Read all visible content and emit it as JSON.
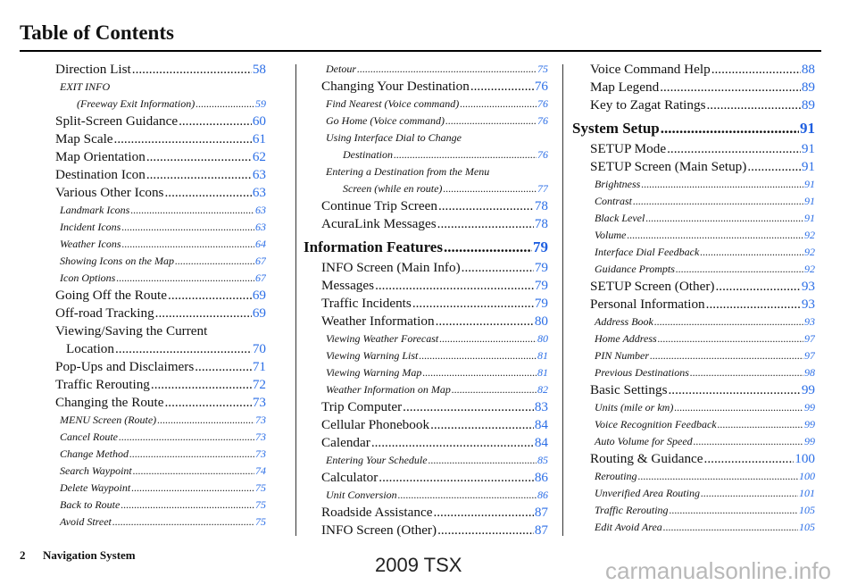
{
  "page": {
    "title": "Table of Contents",
    "footer_page_number": "2",
    "footer_section": "Navigation System",
    "model": "2009  TSX",
    "watermark": "carmanualsonline.info"
  },
  "colors": {
    "link": "#2b6ee6",
    "text": "#111111"
  },
  "columns": [
    {
      "entries": [
        {
          "level": "main",
          "text": "Direction List",
          "page": "58"
        },
        {
          "level": "subplain",
          "text": "EXIT INFO"
        },
        {
          "level": "sub2",
          "text": "(Freeway Exit Information)",
          "page": "59"
        },
        {
          "level": "main",
          "text": "Split-Screen Guidance",
          "page": "60"
        },
        {
          "level": "main",
          "text": "Map Scale",
          "page": "61"
        },
        {
          "level": "main",
          "text": "Map Orientation",
          "page": "62"
        },
        {
          "level": "main",
          "text": "Destination Icon",
          "page": "63"
        },
        {
          "level": "main",
          "text": "Various Other Icons",
          "page": "63"
        },
        {
          "level": "sub",
          "text": "Landmark Icons",
          "page": "63"
        },
        {
          "level": "sub",
          "text": "Incident Icons",
          "page": "63"
        },
        {
          "level": "sub",
          "text": "Weather Icons",
          "page": "64"
        },
        {
          "level": "sub",
          "text": "Showing Icons on the Map",
          "page": "67"
        },
        {
          "level": "sub",
          "text": "Icon Options",
          "page": "67"
        },
        {
          "level": "main",
          "text": "Going Off the Route",
          "page": "69"
        },
        {
          "level": "main",
          "text": "Off-road Tracking",
          "page": "69"
        },
        {
          "level": "mainplain",
          "text": "Viewing/Saving the Current"
        },
        {
          "level": "main2",
          "text": "Location",
          "page": "70"
        },
        {
          "level": "main",
          "text": "Pop-Ups and Disclaimers",
          "page": "71"
        },
        {
          "level": "main",
          "text": "Traffic Rerouting",
          "page": "72"
        },
        {
          "level": "main",
          "text": "Changing the Route",
          "page": "73"
        },
        {
          "level": "sub",
          "text": "MENU Screen (Route)",
          "page": "73"
        },
        {
          "level": "sub",
          "text": "Cancel Route",
          "page": "73"
        },
        {
          "level": "sub",
          "text": "Change Method",
          "page": "73"
        },
        {
          "level": "sub",
          "text": "Search Waypoint",
          "page": "74"
        },
        {
          "level": "sub",
          "text": "Delete Waypoint",
          "page": "75"
        },
        {
          "level": "sub",
          "text": "Back to Route",
          "page": "75"
        },
        {
          "level": "sub",
          "text": "Avoid Street",
          "page": "75"
        }
      ]
    },
    {
      "entries": [
        {
          "level": "sub",
          "text": "Detour",
          "page": "75"
        },
        {
          "level": "main",
          "text": "Changing Your Destination",
          "page": "76"
        },
        {
          "level": "sub",
          "text": "Find Nearest (Voice command)",
          "page": "76"
        },
        {
          "level": "sub",
          "text": "Go Home (Voice command)",
          "page": "76"
        },
        {
          "level": "subplain",
          "text": "Using Interface Dial to Change"
        },
        {
          "level": "sub2",
          "text": "Destination",
          "page": "76"
        },
        {
          "level": "subplain",
          "text": "Entering a Destination from the Menu"
        },
        {
          "level": "sub2",
          "text": "Screen (while en route)",
          "page": "77"
        },
        {
          "level": "main",
          "text": "Continue Trip Screen",
          "page": "78"
        },
        {
          "level": "main",
          "text": "AcuraLink Messages",
          "page": "78"
        },
        {
          "level": "section",
          "text": "Information Features",
          "page": "79"
        },
        {
          "level": "main",
          "text": "INFO Screen (Main Info)",
          "page": "79"
        },
        {
          "level": "main",
          "text": "Messages",
          "page": "79"
        },
        {
          "level": "main",
          "text": "Traffic Incidents",
          "page": "79"
        },
        {
          "level": "main",
          "text": "Weather Information",
          "page": "80"
        },
        {
          "level": "sub",
          "text": "Viewing Weather Forecast",
          "page": "80"
        },
        {
          "level": "sub",
          "text": "Viewing Warning List",
          "page": "81"
        },
        {
          "level": "sub",
          "text": "Viewing Warning Map",
          "page": "81"
        },
        {
          "level": "sub",
          "text": "Weather Information on Map",
          "page": "82"
        },
        {
          "level": "main",
          "text": "Trip Computer",
          "page": "83"
        },
        {
          "level": "main",
          "text": "Cellular Phonebook",
          "page": "84"
        },
        {
          "level": "main",
          "text": "Calendar",
          "page": "84"
        },
        {
          "level": "sub",
          "text": "Entering Your Schedule",
          "page": "85"
        },
        {
          "level": "main",
          "text": "Calculator",
          "page": "86"
        },
        {
          "level": "sub",
          "text": "Unit Conversion",
          "page": "86"
        },
        {
          "level": "main",
          "text": "Roadside Assistance",
          "page": "87"
        },
        {
          "level": "main",
          "text": "INFO Screen (Other)",
          "page": "87"
        }
      ]
    },
    {
      "entries": [
        {
          "level": "main",
          "text": "Voice Command Help",
          "page": "88"
        },
        {
          "level": "main",
          "text": "Map Legend",
          "page": "89"
        },
        {
          "level": "main",
          "text": "Key to Zagat Ratings",
          "page": "89"
        },
        {
          "level": "section",
          "text": "System Setup",
          "page": "91"
        },
        {
          "level": "main",
          "text": "SETUP Mode",
          "page": "91"
        },
        {
          "level": "main",
          "text": "SETUP Screen (Main Setup)",
          "page": "91"
        },
        {
          "level": "sub",
          "text": "Brightness",
          "page": "91"
        },
        {
          "level": "sub",
          "text": "Contrast",
          "page": "91"
        },
        {
          "level": "sub",
          "text": "Black Level",
          "page": "91"
        },
        {
          "level": "sub",
          "text": "Volume",
          "page": "92"
        },
        {
          "level": "sub",
          "text": "Interface Dial Feedback",
          "page": "92"
        },
        {
          "level": "sub",
          "text": "Guidance Prompts",
          "page": "92"
        },
        {
          "level": "main",
          "text": "SETUP Screen (Other)",
          "page": "93"
        },
        {
          "level": "main",
          "text": "Personal Information",
          "page": "93"
        },
        {
          "level": "sub",
          "text": "Address Book",
          "page": "93"
        },
        {
          "level": "sub",
          "text": "Home Address",
          "page": "97"
        },
        {
          "level": "sub",
          "text": "PIN Number",
          "page": "97"
        },
        {
          "level": "sub",
          "text": "Previous Destinations",
          "page": "98"
        },
        {
          "level": "main",
          "text": "Basic Settings",
          "page": "99"
        },
        {
          "level": "sub",
          "text": "Units (mile or km)",
          "page": "99"
        },
        {
          "level": "sub",
          "text": "Voice Recognition Feedback",
          "page": "99"
        },
        {
          "level": "sub",
          "text": "Auto Volume for Speed",
          "page": "99"
        },
        {
          "level": "main",
          "text": "Routing & Guidance",
          "page": "100"
        },
        {
          "level": "sub",
          "text": "Rerouting",
          "page": "100"
        },
        {
          "level": "sub",
          "text": "Unverified Area Routing",
          "page": "101"
        },
        {
          "level": "sub",
          "text": "Traffic Rerouting",
          "page": "105"
        },
        {
          "level": "sub",
          "text": "Edit Avoid Area",
          "page": "105"
        }
      ]
    }
  ]
}
